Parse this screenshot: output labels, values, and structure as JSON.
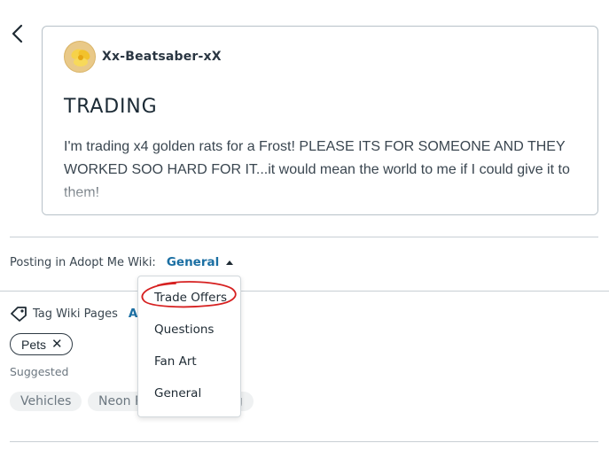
{
  "post": {
    "author": "Xx-Beatsaber-xX",
    "title": "TRADING",
    "body": "I'm trading x4 golden rats for a Frost! PLEASE ITS FOR SOMEONE AND THEY WORKED SOO HARD FOR IT...it would mean the world to me if I could give it to them!"
  },
  "posting": {
    "label": "Posting in Adopt Me Wiki:",
    "category": "General"
  },
  "tags": {
    "label": "Tag Wiki Pages",
    "add_label": "Ad",
    "selected": [
      {
        "label": "Pets",
        "remove": "✕"
      }
    ],
    "suggested_label": "Suggested",
    "suggested": [
      "Vehicles",
      "Neon P",
      "gg"
    ]
  },
  "dropdown": {
    "items": [
      "Trade Offers",
      "Questions",
      "Fan Art",
      "General"
    ],
    "circled_item": "Trade Offers"
  },
  "colors": {
    "accent": "#1b6fa3",
    "annotation": "#d62020"
  },
  "icons": {
    "back": "chevron-left-icon",
    "tag": "tag-icon",
    "caret": "caret-up-icon"
  }
}
